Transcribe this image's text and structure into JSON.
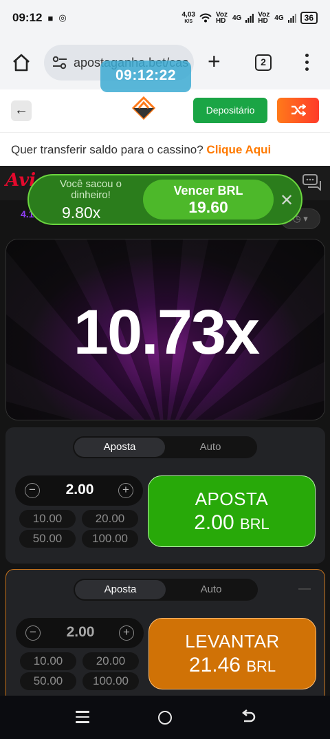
{
  "status_bar": {
    "time": "09:12",
    "net_speed_value": "4,03",
    "net_speed_unit": "K/S",
    "sim1": "Voz HD",
    "sim1_net": "4G",
    "sim2": "Voz HD",
    "sim2_net": "4G",
    "battery": "36"
  },
  "browser": {
    "url": "apostaganha.bet/cas",
    "tab_count": "2",
    "clock_overlay": "09:12:22"
  },
  "site_header": {
    "deposit_label": "Depositário"
  },
  "transfer_bar": {
    "text": "Quer transferir saldo para o cassino? ",
    "cta": "Clique Aqui"
  },
  "game": {
    "logo_text": "Avi",
    "history_first": "4.1",
    "multiplier": "10.73x",
    "cashout_banner": {
      "message": "Você sacou o dinheiro!",
      "multiplier": "9.80x",
      "win_label": "Vencer BRL",
      "win_amount": "19.60"
    },
    "panels": [
      {
        "tab_active": "Aposta",
        "tab_inactive": "Auto",
        "stake": "2.00",
        "quick": [
          "10.00",
          "20.00",
          "50.00",
          "100.00"
        ],
        "button_line1": "APOSTA",
        "button_amount": "2.00",
        "button_currency": "BRL"
      },
      {
        "tab_active": "Aposta",
        "tab_inactive": "Auto",
        "stake": "2.00",
        "quick": [
          "10.00",
          "20.00",
          "50.00",
          "100.00"
        ],
        "button_line1": "LEVANTAR",
        "button_amount": "21.46",
        "button_currency": "BRL"
      }
    ]
  },
  "colors": {
    "bet_green": "#28a909",
    "cashout_orange": "#d07206",
    "deposit_green": "#1aa545",
    "cta_orange": "#ff7a00",
    "aviator_red": "#e5092d"
  }
}
